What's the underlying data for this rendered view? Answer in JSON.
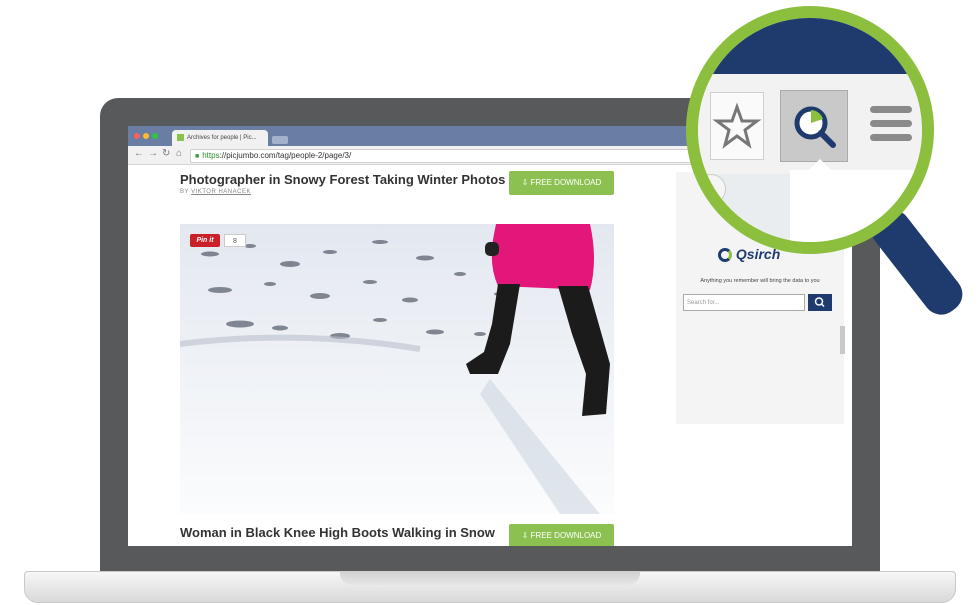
{
  "browser": {
    "tab_title": "Archives for people | Pic...",
    "url_https": "https",
    "url_rest": "://picjumbo.com/tag/people-2/page/3/"
  },
  "posts": [
    {
      "title": "Photographer in Snowy Forest Taking Winter Photos",
      "by_prefix": "BY",
      "author": "VIKTOR HANACEK",
      "download_label": "FREE DOWNLOAD"
    },
    {
      "title": "Woman in Black Knee High Boots Walking in Snow",
      "download_label": "FREE DOWNLOAD"
    }
  ],
  "pinit": {
    "label": "Pin it",
    "count": "8"
  },
  "qsirch_popup": {
    "logo": "Qsirch",
    "tagline": "Anything you remember will bring the data to you",
    "search_placeholder": "Search for..."
  },
  "colors": {
    "accent_green": "#8dbf3e",
    "brand_navy": "#1f3b6e",
    "download_green": "#8cc152",
    "pinterest_red": "#cb2027",
    "coat_pink": "#e3177a"
  },
  "icons": [
    "star-icon",
    "qsirch-icon",
    "menu-icon",
    "download-icon",
    "search-icon",
    "lock-icon",
    "back-icon",
    "forward-icon",
    "reload-icon",
    "home-icon"
  ]
}
